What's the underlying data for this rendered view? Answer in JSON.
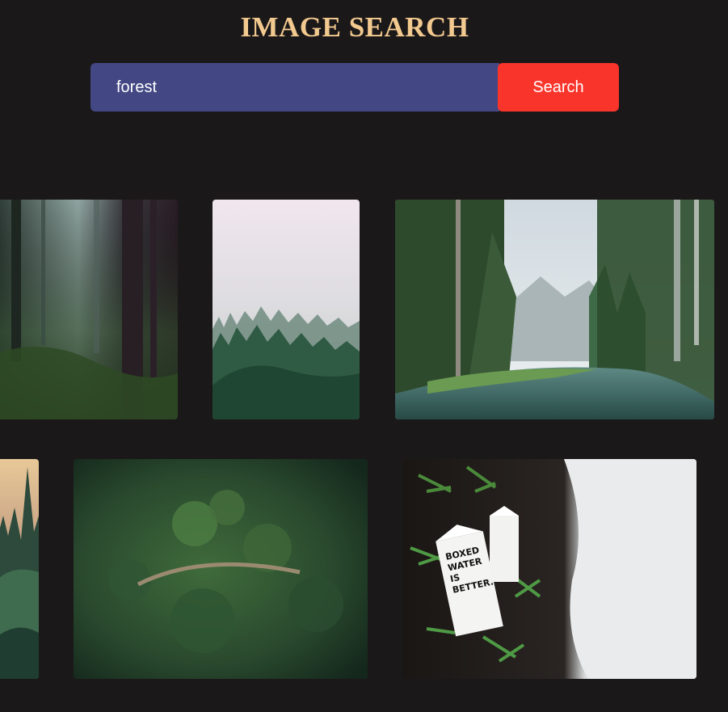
{
  "header": {
    "title": "IMAGE SEARCH"
  },
  "search": {
    "value": "forest",
    "button_label": "Search"
  },
  "results": [
    {
      "name": "misty-dark-forest-image",
      "icon": "photo"
    },
    {
      "name": "foggy-pine-treetops-image",
      "icon": "photo"
    },
    {
      "name": "mountain-lake-forest-image",
      "icon": "photo"
    },
    {
      "name": "sunset-forest-hill-image",
      "icon": "photo"
    },
    {
      "name": "aerial-forest-road-image",
      "icon": "photo"
    },
    {
      "name": "boxed-water-cartons-image",
      "icon": "photo"
    }
  ],
  "boxed_water_text": [
    "BOXED",
    "WATER",
    "IS",
    "BETTER."
  ],
  "colors": {
    "background": "#1b1819",
    "title": "#f2c98f",
    "input_bg": "#434884",
    "button_bg": "#f9352b"
  }
}
